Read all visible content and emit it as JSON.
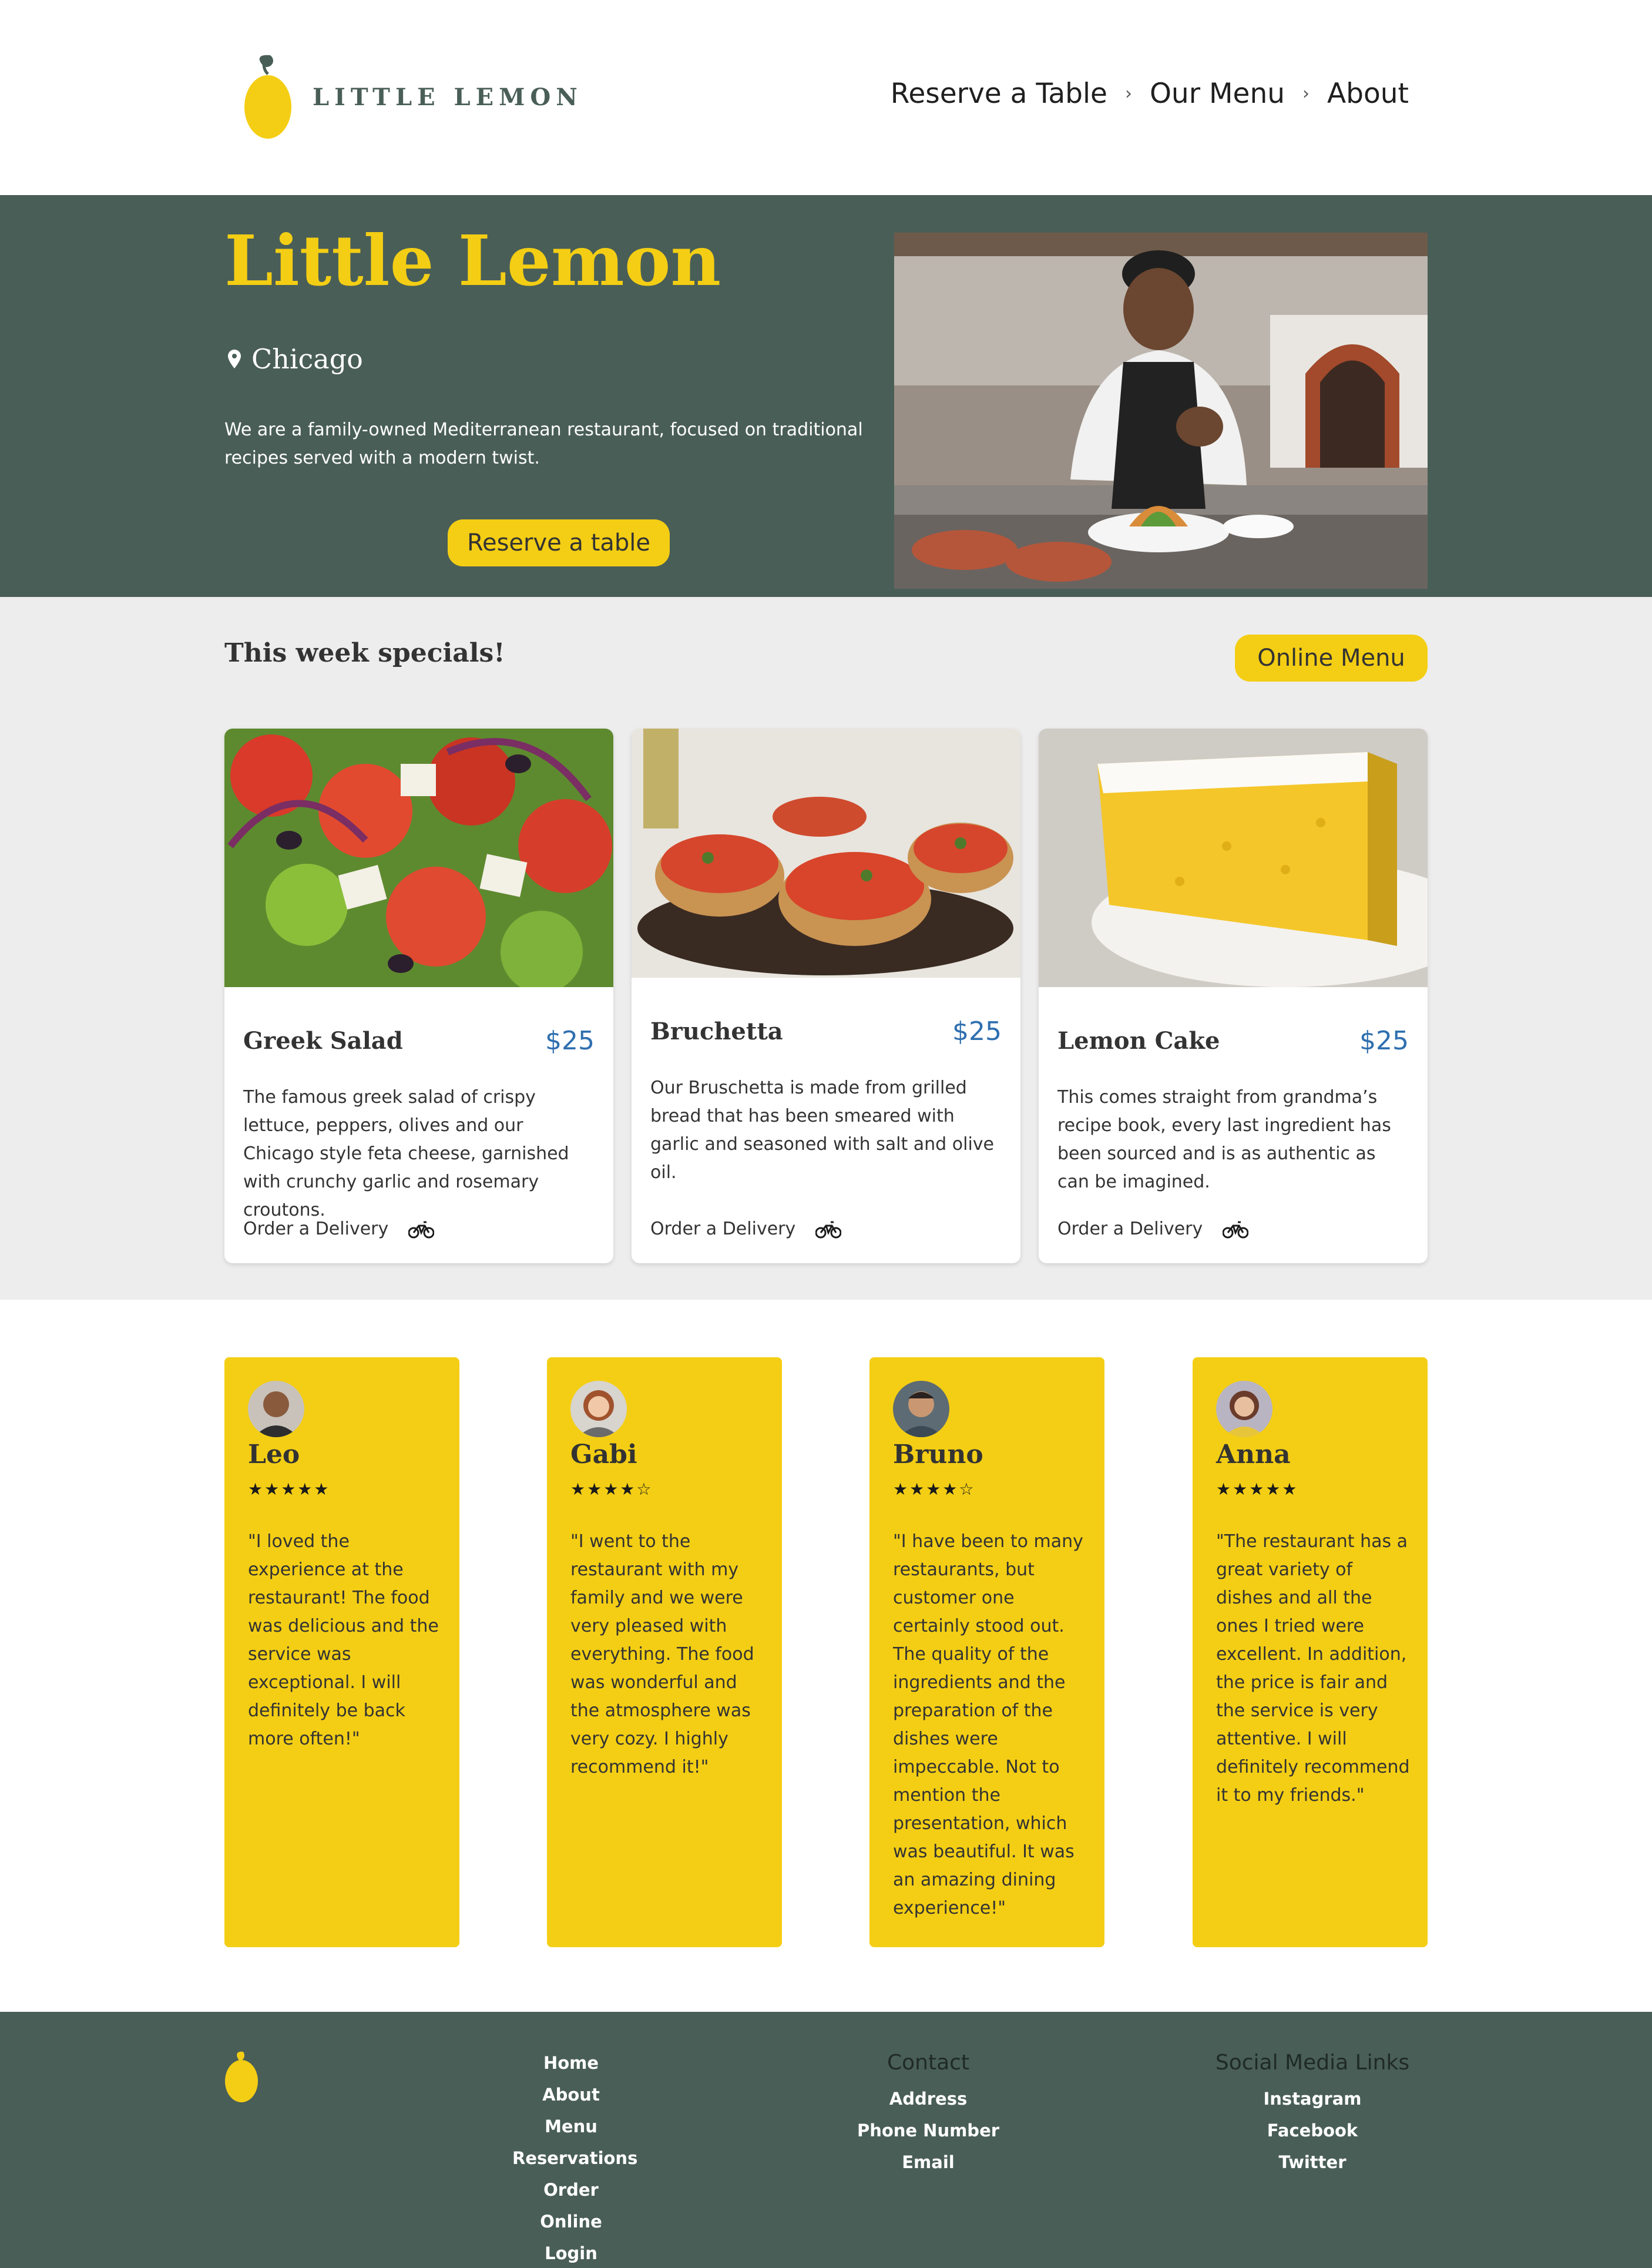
{
  "header": {
    "logo_text": "LITTLE LEMON",
    "nav": [
      {
        "label": "Reserve a Table"
      },
      {
        "label": "Our Menu"
      },
      {
        "label": "About"
      }
    ],
    "separator": "›"
  },
  "hero": {
    "title": "Little Lemon",
    "city": "Chicago",
    "description": "We are a family-owned Mediterranean restaurant, focused on traditional recipes served with a modern twist.",
    "button_label": "Reserve a table"
  },
  "specials": {
    "title": "This week specials!",
    "button_label": "Online Menu",
    "items": [
      {
        "name": "Greek Salad",
        "price": "$25",
        "description": "The famous greek salad of crispy lettuce, peppers, olives and our Chicago style feta cheese, garnished with crunchy garlic and rosemary croutons.",
        "order_label": "Order a Delivery"
      },
      {
        "name": "Bruchetta",
        "price": "$25",
        "description": "Our Bruschetta is made from grilled bread that has been smeared with garlic and seasoned with salt and olive oil.",
        "order_label": "Order a Delivery"
      },
      {
        "name": "Lemon Cake",
        "price": "$25",
        "description": "This comes straight from grandma’s recipe book, every last ingredient has been sourced and is as authentic as can be imagined.",
        "order_label": "Order a Delivery"
      }
    ]
  },
  "testimonials": [
    {
      "name": "Leo",
      "stars": "★★★★★",
      "rating": 5,
      "quote": "\"I loved the experience at the restaurant! The food was delicious and the service was exceptional. I will definitely be back more often!\""
    },
    {
      "name": "Gabi",
      "stars": "★★★★☆",
      "rating": 4,
      "quote": "\"I went to the restaurant with my family and we were very pleased with everything. The food was wonderful and the atmosphere was very cozy. I highly recommend it!\""
    },
    {
      "name": "Bruno",
      "stars": "★★★★☆",
      "rating": 4,
      "quote": "\"I have been to many restaurants, but customer one certainly stood out. The quality of the ingredients and the preparation of the dishes were impeccable. Not to mention the presentation, which was beautiful. It was an amazing dining experience!\""
    },
    {
      "name": "Anna",
      "stars": "★★★★★",
      "rating": 5,
      "quote": "\"The restaurant has a great variety of dishes and all the ones I tried were excellent. In addition, the price is fair and the service is very attentive. I will definitely recommend it to my friends.\""
    }
  ],
  "footer": {
    "nav_links": [
      "Home",
      "About",
      "Menu",
      "Reservations",
      "Order Online",
      "Login"
    ],
    "contact": {
      "heading": "Contact",
      "links": [
        "Address",
        "Phone Number",
        "Email"
      ]
    },
    "social": {
      "heading": "Social Media Links",
      "links": [
        "Instagram",
        "Facebook",
        "Twitter"
      ]
    }
  },
  "colors": {
    "primary_green": "#495E57",
    "primary_yellow": "#F4CE14",
    "light_gray": "#EDEDED",
    "price_blue": "#2F6FAF",
    "dark_text": "#333333"
  },
  "icons": [
    "lemon-logo-icon",
    "chevron-right-icon",
    "location-pin-icon",
    "bicycle-icon"
  ]
}
